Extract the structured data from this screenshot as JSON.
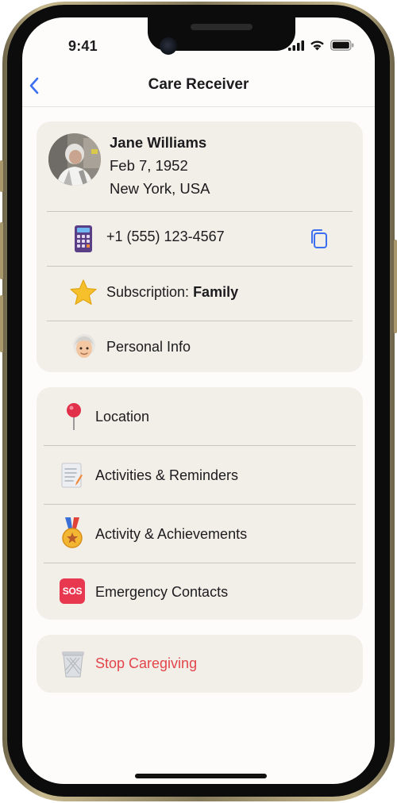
{
  "status_bar": {
    "time": "9:41"
  },
  "nav": {
    "title": "Care Receiver",
    "back_icon": "chevron-left-icon"
  },
  "profile": {
    "name": "Jane Williams",
    "dob": "Feb 7, 1952",
    "location": "New York, USA"
  },
  "details": {
    "phone": "+1 (555) 123-4567",
    "subscription_label": "Subscription: ",
    "subscription_value": "Family",
    "personal_info": "Personal Info"
  },
  "menu": {
    "location": "Location",
    "activities_reminders": "Activities & Reminders",
    "activity_achievements": "Activity & Achievements",
    "emergency_contacts": "Emergency Contacts",
    "sos_badge": "SOS"
  },
  "danger": {
    "stop_caregiving": "Stop Caregiving"
  },
  "colors": {
    "accent": "#3b6ef0",
    "danger": "#e4454b",
    "card": "#f2eee8"
  }
}
